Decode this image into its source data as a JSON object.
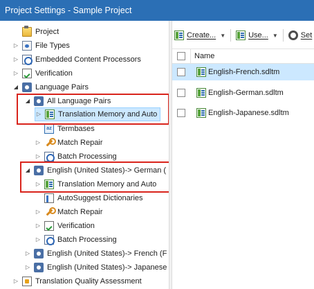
{
  "window": {
    "title": "Project Settings - Sample Project"
  },
  "tree": {
    "items": [
      {
        "label": "Project",
        "icon": "project-icon",
        "expander": "none"
      },
      {
        "label": "File Types",
        "icon": "file-types-icon",
        "expander": "collapsed"
      },
      {
        "label": "Embedded Content Processors",
        "icon": "processor-icon",
        "expander": "collapsed"
      },
      {
        "label": "Verification",
        "icon": "verification-icon",
        "expander": "collapsed"
      },
      {
        "label": "Language Pairs",
        "icon": "language-pairs-icon",
        "expander": "expanded"
      },
      {
        "label": "All Language Pairs",
        "icon": "language-pair-icon",
        "expander": "expanded"
      },
      {
        "label": "Translation Memory and Auto",
        "icon": "translation-memory-icon",
        "expander": "collapsed"
      },
      {
        "label": "Termbases",
        "icon": "termbase-icon",
        "expander": "none"
      },
      {
        "label": "Match Repair",
        "icon": "wrench-icon",
        "expander": "collapsed"
      },
      {
        "label": "Batch Processing",
        "icon": "batch-icon",
        "expander": "collapsed"
      },
      {
        "label": "English (United States)-> German (",
        "icon": "language-pair-icon",
        "expander": "expanded"
      },
      {
        "label": "Translation Memory and Auto",
        "icon": "translation-memory-icon",
        "expander": "collapsed"
      },
      {
        "label": "AutoSuggest Dictionaries",
        "icon": "dictionary-icon",
        "expander": "none"
      },
      {
        "label": "Match Repair",
        "icon": "wrench-icon",
        "expander": "collapsed"
      },
      {
        "label": "Verification",
        "icon": "verification-icon",
        "expander": "collapsed"
      },
      {
        "label": "Batch Processing",
        "icon": "batch-icon",
        "expander": "collapsed"
      },
      {
        "label": "English (United States)-> French (F",
        "icon": "language-pair-icon",
        "expander": "collapsed"
      },
      {
        "label": "English (United States)-> Japanese",
        "icon": "language-pair-icon",
        "expander": "collapsed"
      },
      {
        "label": "Translation Quality Assessment",
        "icon": "tqa-icon",
        "expander": "collapsed"
      }
    ],
    "selected_index": 6
  },
  "toolbar": {
    "create_label": "Create...",
    "use_label": "Use...",
    "settings_label": "Set"
  },
  "list": {
    "column_name": "Name",
    "files": [
      {
        "name": "English-French.sdltm",
        "selected": true
      },
      {
        "name": "English-German.sdltm",
        "selected": false
      },
      {
        "name": "English-Japanese.sdltm",
        "selected": false
      }
    ]
  },
  "colors": {
    "titlebar": "#2b6fb5",
    "selection": "#cce8ff",
    "highlight_box": "#d9241c"
  }
}
